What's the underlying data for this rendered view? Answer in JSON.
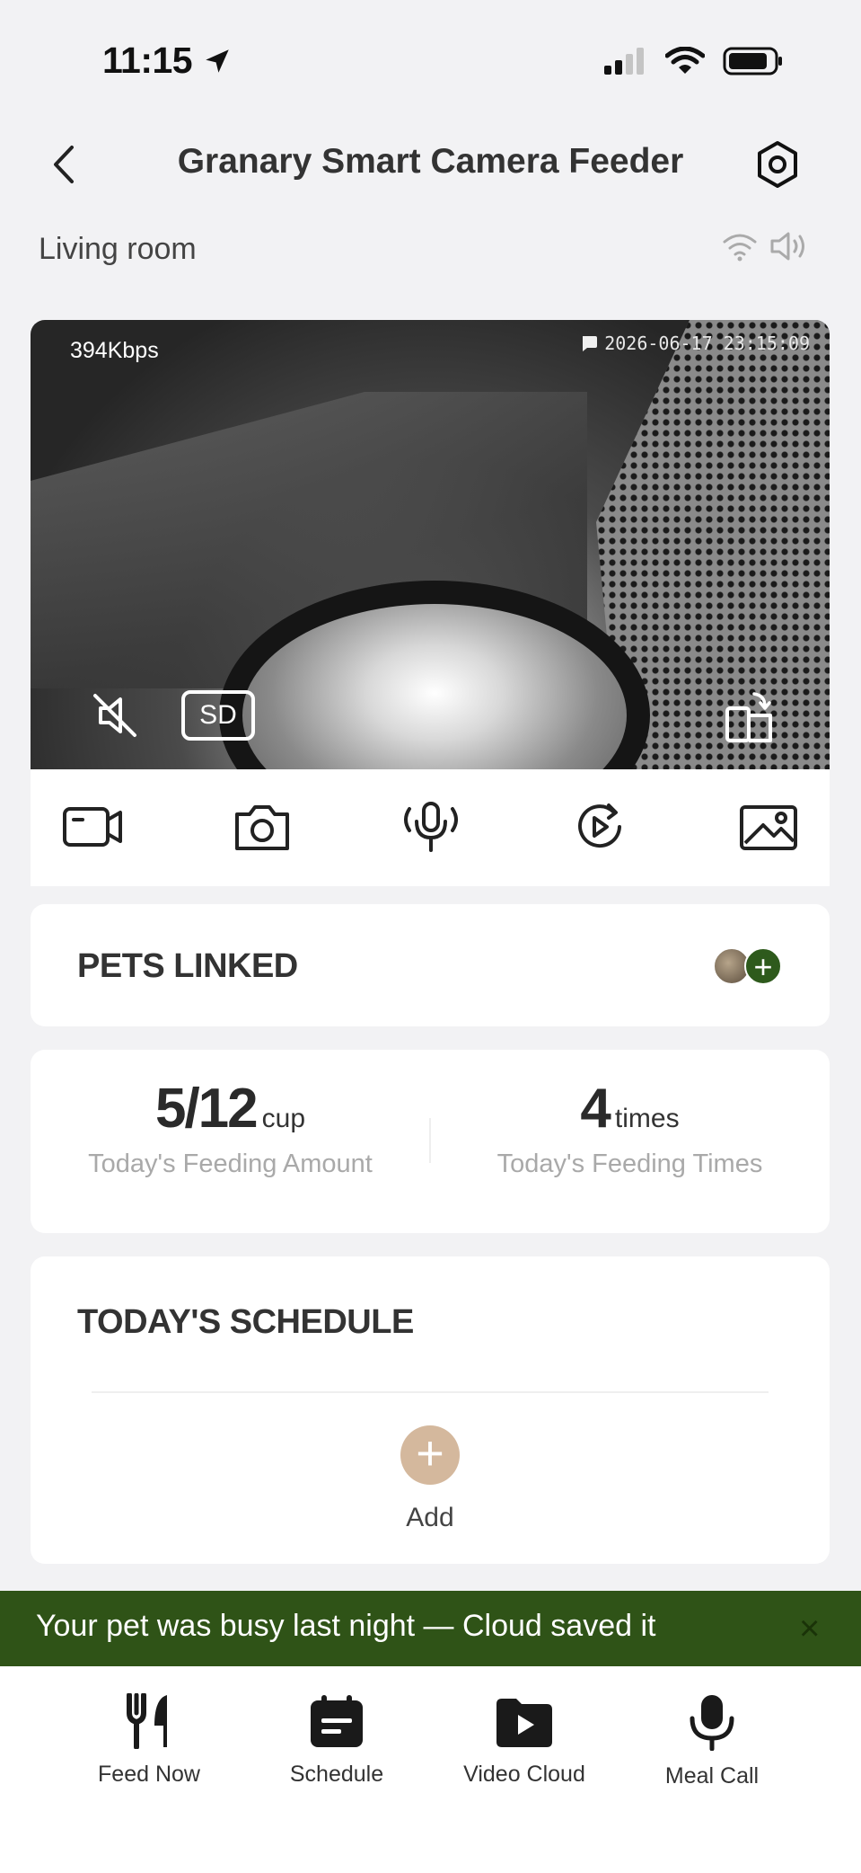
{
  "status_bar": {
    "time": "11:15"
  },
  "header": {
    "title": "Granary Smart Camera Feeder"
  },
  "location": {
    "room": "Living room"
  },
  "video": {
    "bitrate": "394Kbps",
    "timestamp": "2026-06-17 23:15:09",
    "sd_label": "SD"
  },
  "toolbar": {
    "icons": [
      "record-icon",
      "camera-icon",
      "intercom-icon",
      "playback-icon",
      "gallery-icon"
    ]
  },
  "pets": {
    "title": "PETS LINKED",
    "add_symbol": "+"
  },
  "stats": {
    "amount_value": "5/12",
    "amount_unit": "cup",
    "amount_label": "Today's Feeding Amount",
    "times_value": "4",
    "times_unit": "times",
    "times_label": "Today's Feeding Times"
  },
  "schedule": {
    "title": "TODAY'S SCHEDULE",
    "add_symbol": "+",
    "add_label": "Add"
  },
  "banner": {
    "text": "Your pet was busy last night — Cloud saved it",
    "close_symbol": "×"
  },
  "bottom_nav": {
    "items": [
      {
        "label": "Feed Now",
        "icon": "utensils-icon"
      },
      {
        "label": "Schedule",
        "icon": "calendar-icon"
      },
      {
        "label": "Video Cloud",
        "icon": "video-folder-icon"
      },
      {
        "label": "Meal Call",
        "icon": "microphone-icon"
      }
    ]
  },
  "colors": {
    "accent_green": "#2f5317",
    "add_tan": "#d4b89d",
    "background": "#f2f2f4"
  }
}
